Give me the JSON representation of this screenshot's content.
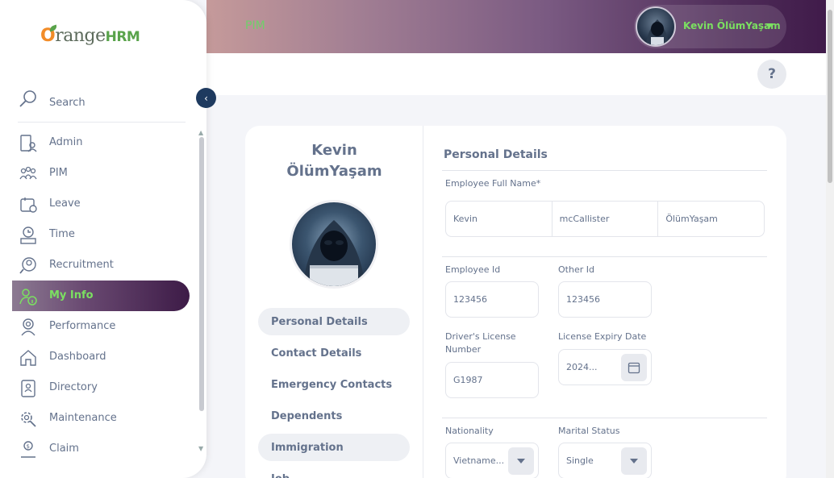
{
  "header": {
    "module": "PIM",
    "user_name": "Kevin ÖlümYaşam",
    "help": "?"
  },
  "sidebar": {
    "logo": {
      "o": "O",
      "range": "range",
      "hrm": "HRM"
    },
    "search_label": "Search",
    "items": [
      {
        "label": "Admin",
        "icon": "admin-icon"
      },
      {
        "label": "PIM",
        "icon": "pim-icon"
      },
      {
        "label": "Leave",
        "icon": "leave-icon"
      },
      {
        "label": "Time",
        "icon": "time-icon"
      },
      {
        "label": "Recruitment",
        "icon": "recruitment-icon"
      },
      {
        "label": "My Info",
        "icon": "my-info-icon"
      },
      {
        "label": "Performance",
        "icon": "performance-icon"
      },
      {
        "label": "Dashboard",
        "icon": "dashboard-icon"
      },
      {
        "label": "Directory",
        "icon": "directory-icon"
      },
      {
        "label": "Maintenance",
        "icon": "maintenance-icon"
      },
      {
        "label": "Claim",
        "icon": "claim-icon"
      }
    ],
    "active": "My Info"
  },
  "profile": {
    "first_name_line": "Kevin",
    "last_name_line": "ÖlümYaşam",
    "tabs": [
      "Personal Details",
      "Contact Details",
      "Emergency Contacts",
      "Dependents",
      "Immigration",
      "Job"
    ],
    "selected_tab": "Personal Details"
  },
  "form": {
    "section_title": "Personal Details",
    "full_name_label": "Employee Full Name*",
    "first_name": "Kevin",
    "middle_name": "mcCallister",
    "last_name": "ÖlümYaşam",
    "employee_id_label": "Employee Id",
    "employee_id": "123456",
    "other_id_label": "Other Id",
    "other_id": "123456",
    "license_label": "Driver's License Number",
    "license_number": "G1987",
    "expiry_label": "License Expiry Date",
    "expiry_value": "2024...",
    "nationality_label": "Nationality",
    "nationality_value": "Vietname...",
    "marital_label": "Marital Status",
    "marital_value": "Single"
  }
}
